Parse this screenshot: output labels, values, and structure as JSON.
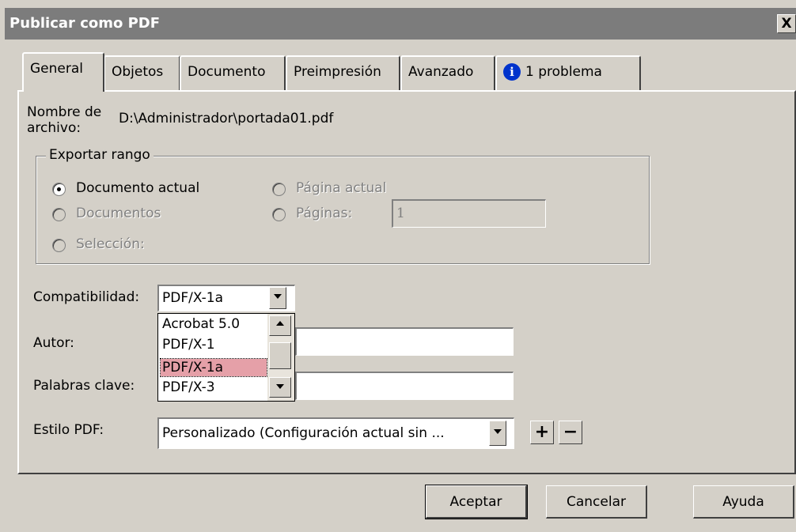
{
  "window": {
    "title": "Publicar como PDF",
    "close_label": "X"
  },
  "tabs": [
    {
      "label": "General"
    },
    {
      "label": "Objetos"
    },
    {
      "label": "Documento"
    },
    {
      "label": "Preimpresión"
    },
    {
      "label": "Avanzado"
    },
    {
      "label": "1 problema",
      "icon": "info-icon"
    }
  ],
  "filename": {
    "label_line1": "Nombre de",
    "label_line2": "archivo:",
    "value": "D:\\Administrador\\portada01.pdf"
  },
  "export_range": {
    "legend": "Exportar rango",
    "options": [
      {
        "label": "Documento actual",
        "selected": true,
        "enabled": true
      },
      {
        "label": "Documentos",
        "selected": false,
        "enabled": false
      },
      {
        "label": "Selección:",
        "selected": false,
        "enabled": false
      },
      {
        "label": "Página actual",
        "selected": false,
        "enabled": false
      },
      {
        "label": "Páginas:",
        "selected": false,
        "enabled": false
      }
    ],
    "pages_value": "1"
  },
  "compat": {
    "label": "Compatibilidad:",
    "selected": "PDF/X-1a",
    "options": [
      "Acrobat 5.0",
      "PDF/X-1",
      "PDF/X-1a",
      "PDF/X-3"
    ],
    "highlight_color": "#e5a0a8"
  },
  "author": {
    "label": "Autor:",
    "value": ""
  },
  "keywords": {
    "label": "Palabras clave:",
    "value": ""
  },
  "pdf_style": {
    "label": "Estilo PDF:",
    "value": "Personalizado (Configuración actual sin ...",
    "add_label": "+",
    "remove_label": "−"
  },
  "buttons": {
    "ok": "Aceptar",
    "cancel": "Cancelar",
    "help": "Ayuda"
  }
}
